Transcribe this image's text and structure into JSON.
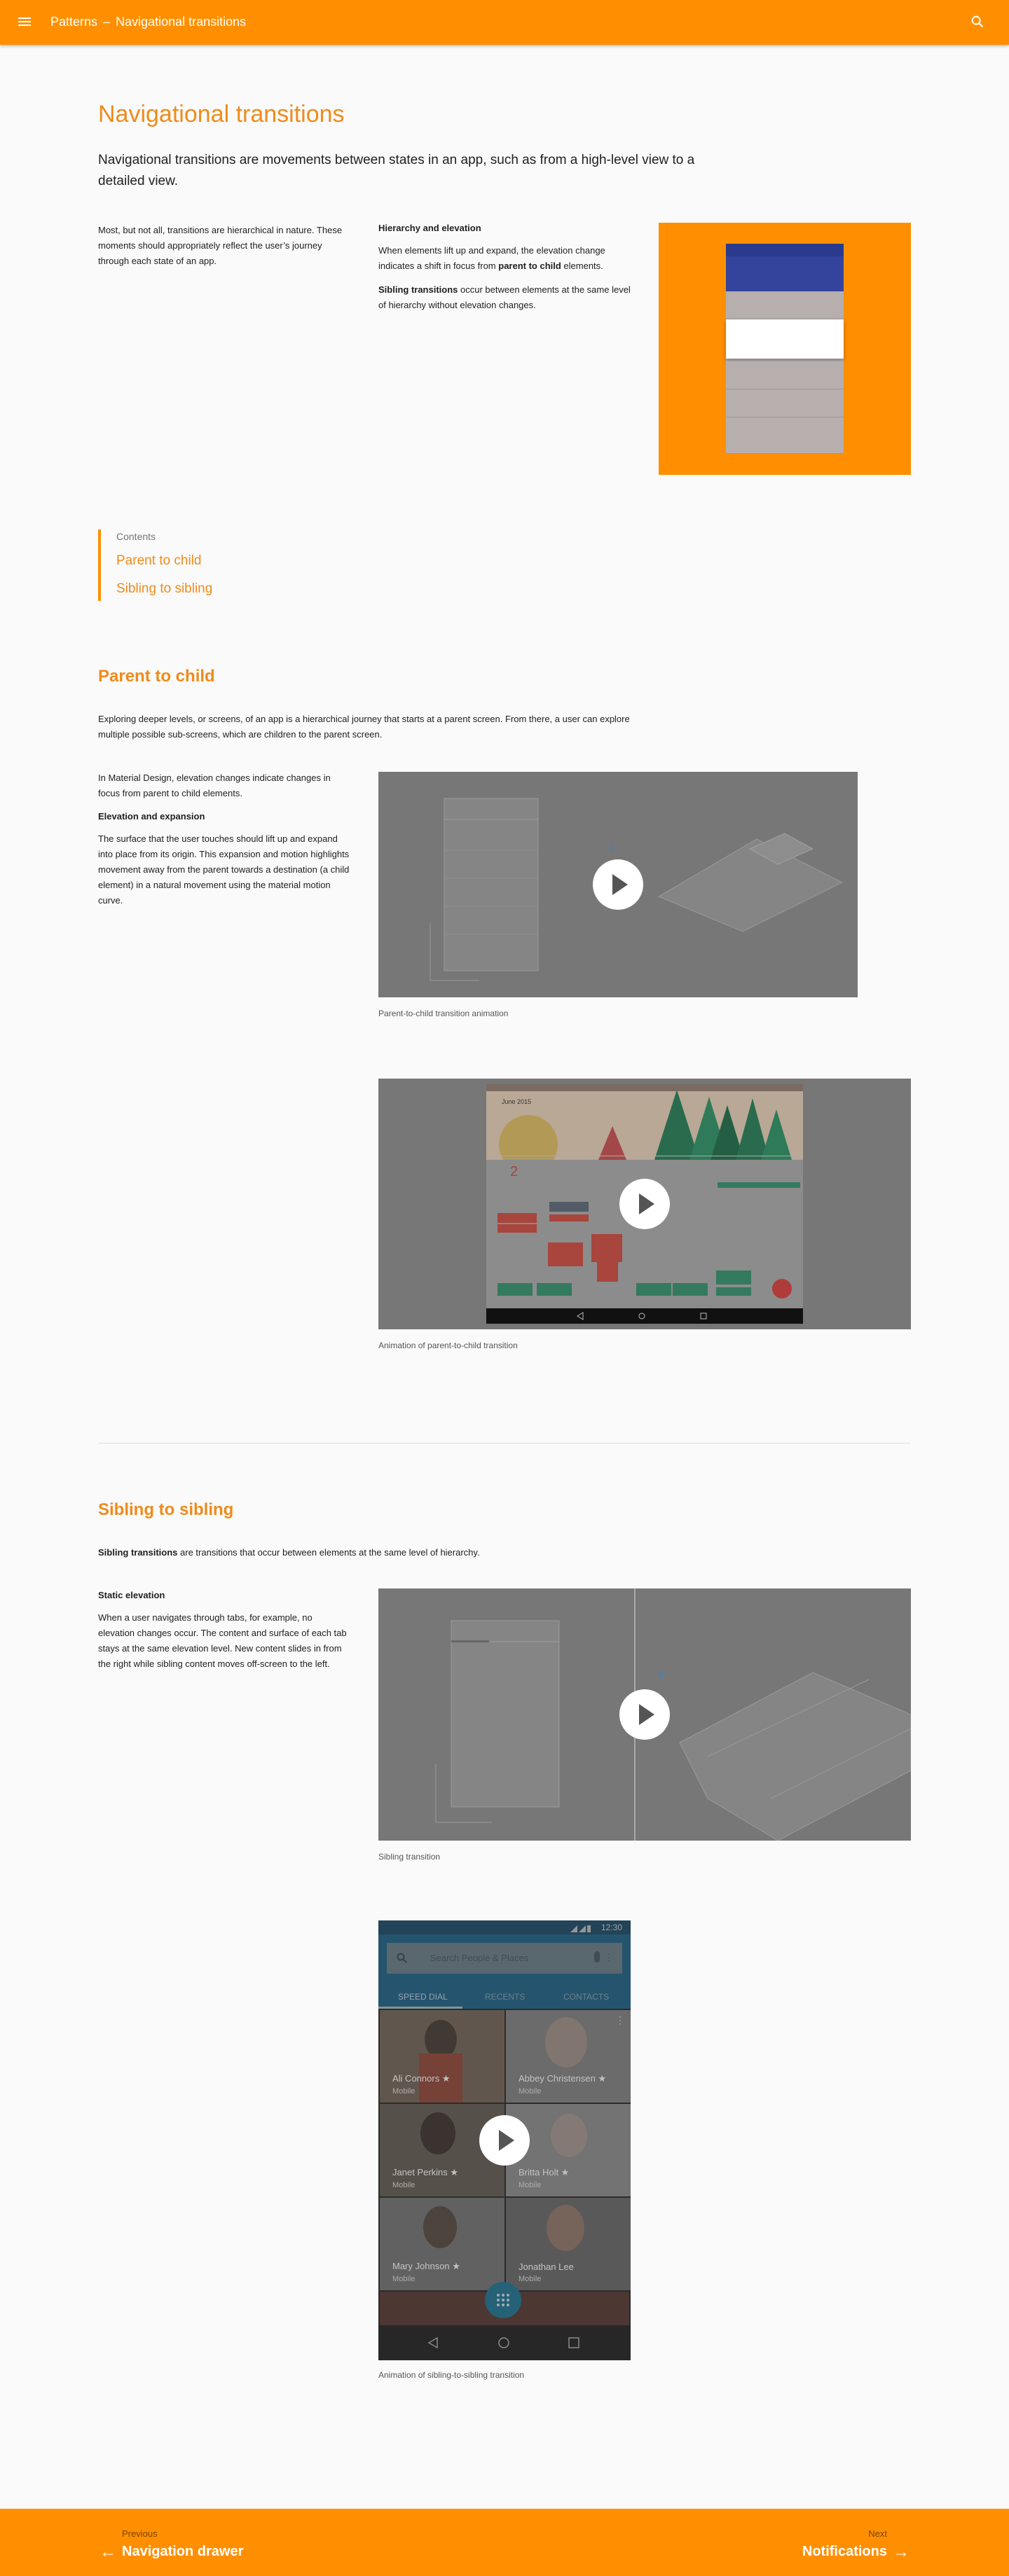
{
  "header": {
    "section": "Patterns",
    "separator": "–",
    "page": "Navigational transitions"
  },
  "intro": {
    "title": "Navigational transitions",
    "lead": "Navigational transitions are movements between states in an app, such as from a high-level view to a detailed view.",
    "col1": "Most, but not all, transitions are hierarchical in nature. These moments should appropriately reflect the user’s journey through each state of an app.",
    "col2_heading": "Hierarchy and elevation",
    "col2_p1_before": "When elements lift up and expand, the elevation change indicates a shift in focus from ",
    "col2_p1_bold": "parent to child",
    "col2_p1_after": " elements.",
    "col2_p2_bold": "Sibling transitions",
    "col2_p2_after": " occur between elements at the same level of hierarchy without elevation changes."
  },
  "toc": {
    "title": "Contents",
    "links": [
      "Parent to child",
      "Sibling to sibling"
    ]
  },
  "parent": {
    "title": "Parent to child",
    "intro": "Exploring deeper levels, or screens, of an app is a hierarchical journey that starts at a parent screen. From there, a user can explore multiple possible sub-screens, which are children to the parent screen.",
    "p1": "In Material Design, elevation changes indicate changes in focus from parent to child elements.",
    "heading": "Elevation and expansion",
    "p2": "The surface that the user touches should lift up and expand into place from its origin. This expansion and motion highlights movement away from the parent towards a destination (a child element) in a natural movement using the material motion curve.",
    "caption1": "Parent-to-child transition animation",
    "caption2": "Animation of parent-to-child transition",
    "calendar_month": "June 2015",
    "calendar_day": "2"
  },
  "sibling": {
    "title": "Sibling to sibling",
    "intro_bold": "Sibling transitions",
    "intro_after": " are transitions that occur between elements at the same level of hierarchy.",
    "heading": "Static elevation",
    "p1": "When a user navigates through tabs, for example, no elevation changes occur. The content and surface of each tab stays at the same elevation level. New content slides in from the right while sibling content moves off-screen to the left.",
    "caption1": "Sibling transition",
    "caption2": "Animation of sibling-to-sibling transition"
  },
  "phone": {
    "time": "12:30",
    "search_placeholder": "Search People & Places",
    "tabs": [
      "SPEED DIAL",
      "RECENTS",
      "CONTACTS"
    ],
    "contacts": [
      {
        "name": "Ali Connors ★",
        "type": "Mobile"
      },
      {
        "name": "Abbey Christensen ★",
        "type": "Mobile"
      },
      {
        "name": "Janet Perkins ★",
        "type": "Mobile"
      },
      {
        "name": "Britta Holt ★",
        "type": "Mobile"
      },
      {
        "name": "Mary Johnson ★",
        "type": "Mobile"
      },
      {
        "name": "Jonathan Lee",
        "type": "Mobile"
      }
    ]
  },
  "footer": {
    "prev_small": "Previous",
    "prev_title": "Navigation drawer",
    "next_small": "Next",
    "next_title": "Notifications"
  },
  "colors": {
    "accent": "#ff8f00",
    "title_orange": "#ef8b1b",
    "indigo": "#34449c"
  }
}
